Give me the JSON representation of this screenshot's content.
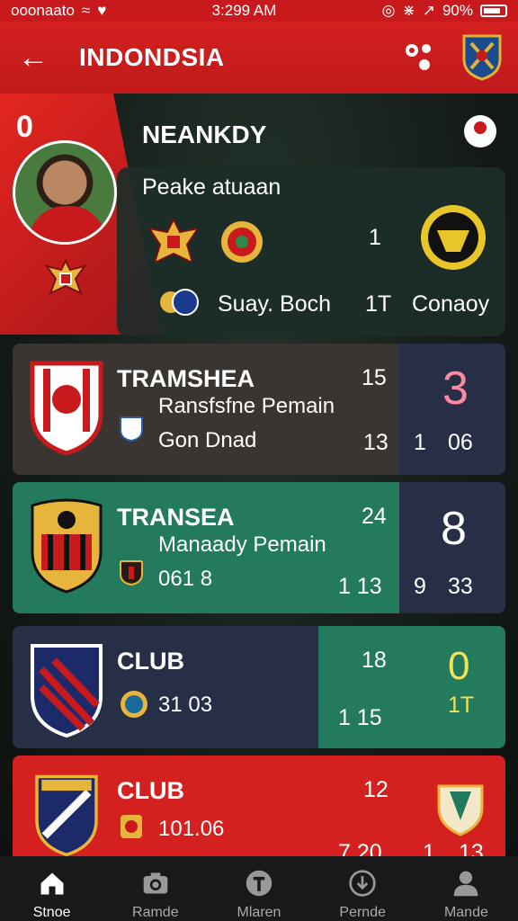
{
  "status_bar": {
    "carrier": "ooonaato",
    "time": "3:299 AM",
    "battery": "90%"
  },
  "app_bar": {
    "title": "INDONDSIA",
    "back_icon": "arrow-left-icon",
    "share_icon": "share-icon",
    "crest_icon": "team-crest-icon"
  },
  "hero": {
    "rank": "0",
    "player_name": "NEANKDY",
    "card_label": "Peake atuaan",
    "value_1": "1",
    "club_name": "Suay. Boch",
    "value_2": "1T",
    "club_name_2": "Conaoy"
  },
  "rows": [
    {
      "name": "TRAMSHEA",
      "sub1": "Ransfsfne Pemain",
      "sub2": "Gon Dnad",
      "num1": "15",
      "num2": "13",
      "side_big": "3",
      "side_small_1": "1",
      "side_small_2": "06"
    },
    {
      "name": "TRANSEA",
      "sub1": "Manaady Pemain",
      "sub2": "061 8",
      "num1": "24",
      "num2": "1 13",
      "side_big": "8",
      "side_small_1": "9",
      "side_small_2": "33"
    },
    {
      "name": "CLUB",
      "sub1": "",
      "sub2": "31 03",
      "num1": "18",
      "num2": "1 15",
      "side_big": "0",
      "side_small_1": "1T",
      "side_small_2": ""
    },
    {
      "name": "CLUB",
      "sub1": "",
      "sub2": "101.06",
      "num1": "12",
      "num2": "7 20",
      "side_big": "",
      "side_small_1": "1",
      "side_small_2": "13"
    }
  ],
  "tabs": [
    {
      "label": "Stnoe",
      "icon": "home-icon"
    },
    {
      "label": "Ramde",
      "icon": "camera-icon"
    },
    {
      "label": "Mlaren",
      "icon": "info-icon"
    },
    {
      "label": "Pernde",
      "icon": "download-icon"
    },
    {
      "label": "Mande",
      "icon": "person-icon"
    }
  ],
  "colors": {
    "red": "#d4201f",
    "green": "#237a5c",
    "navy": "#272f47",
    "dark": "#1e2b28"
  }
}
